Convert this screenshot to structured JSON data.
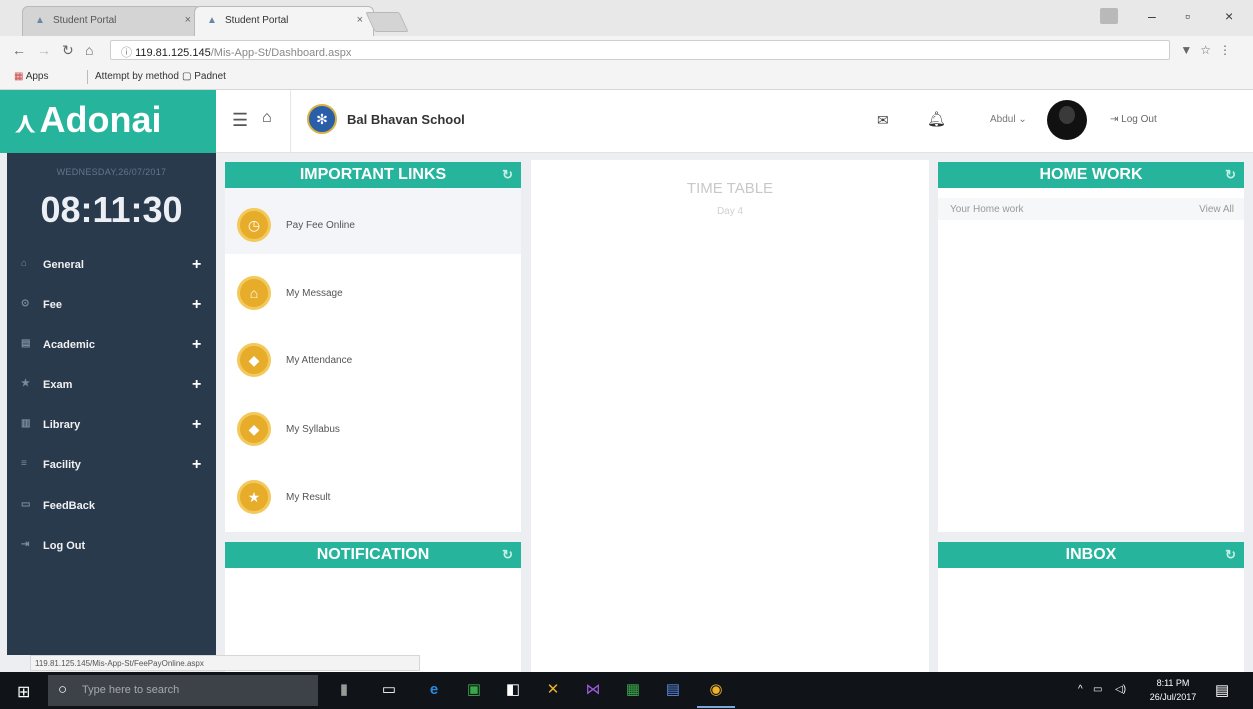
{
  "browser": {
    "tabs": [
      {
        "title": "Student Portal",
        "close": "×",
        "active": false
      },
      {
        "title": "Student Portal",
        "close": "×",
        "active": true
      }
    ],
    "window_controls": {
      "minimize": "–",
      "maximize": "▫",
      "close": "×"
    },
    "url_host": "119.81.125.145",
    "url_path": "/Mis-App-St/Dashboard.aspx",
    "bookmarks": [
      "Apps",
      "Attempt by method",
      "Padnet"
    ],
    "status_url": "119.81.125.145/Mis-App-St/FeePayOnline.aspx"
  },
  "header": {
    "brand": "Adonai",
    "school_name": "Bal Bhavan School",
    "user_name": "Abdul",
    "logout_label": "Log Out"
  },
  "sidebar": {
    "date": "WEDNESDAY,26/07/2017",
    "time": "08:11:30",
    "items": [
      {
        "label": "General",
        "icon": "home-icon",
        "expandable": true
      },
      {
        "label": "Fee",
        "icon": "location-icon",
        "expandable": true
      },
      {
        "label": "Academic",
        "icon": "book-icon",
        "expandable": true
      },
      {
        "label": "Exam",
        "icon": "star-icon",
        "expandable": true
      },
      {
        "label": "Library",
        "icon": "library-icon",
        "expandable": true
      },
      {
        "label": "Facility",
        "icon": "facility-icon",
        "expandable": true
      },
      {
        "label": "FeedBack",
        "icon": "feedback-icon",
        "expandable": false
      },
      {
        "label": "Log Out",
        "icon": "logout-icon",
        "expandable": false
      }
    ]
  },
  "important_links": {
    "title": "IMPORTANT LINKS",
    "items": [
      {
        "label": "Pay Fee Online",
        "icon": "clock-icon"
      },
      {
        "label": "My Message",
        "icon": "home-icon"
      },
      {
        "label": "My Attendance",
        "icon": "graduation-cap-icon"
      },
      {
        "label": "My Syllabus",
        "icon": "graduation-cap-icon"
      },
      {
        "label": "My Result",
        "icon": "star-icon"
      }
    ]
  },
  "notification": {
    "title": "NOTIFICATION"
  },
  "timetable": {
    "title": "TIME TABLE",
    "day": "Day 4"
  },
  "homework": {
    "title": "HOME WORK",
    "subtitle": "Your Home work",
    "view_all": "View All"
  },
  "inbox": {
    "title": "INBOX"
  },
  "taskbar": {
    "search_placeholder": "Type here to search",
    "time": "8:11 PM",
    "date": "26/Jul/2017"
  },
  "colors": {
    "accent": "#26b59c",
    "sidebar": "#2a3a4d",
    "link_icon": "#e6ac2a"
  }
}
